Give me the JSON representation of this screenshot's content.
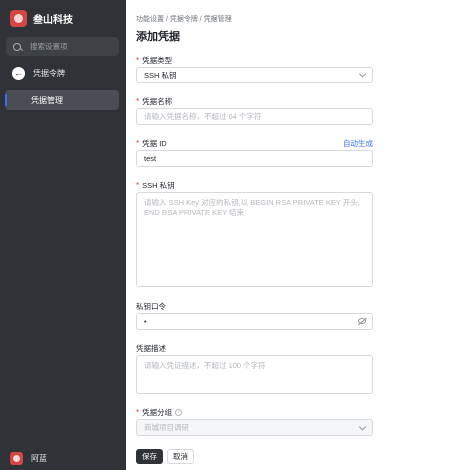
{
  "sidebar": {
    "brand": "叁山科技",
    "search_placeholder": "搜索设置项",
    "back_label": "凭据令牌",
    "active_item": "凭据管理",
    "user_name": "阿蓝"
  },
  "main": {
    "breadcrumb": "功能设置 / 凭据令牌 / 凭据管理",
    "title": "添加凭据",
    "fields": {
      "type": {
        "label": "凭据类型",
        "value": "SSH 私钥"
      },
      "name": {
        "label": "凭据名称",
        "placeholder": "请输入凭据名称，不超过 64 个字符"
      },
      "id": {
        "label": "凭据 ID",
        "value": "test",
        "auto_link": "自动生成"
      },
      "ssh_key": {
        "label": "SSH 私钥",
        "placeholder": "请输入 SSH Key 对应的私钥,以 BEGIN RSA PRIVATE KEY 开头, END RSA PRIVATE KEY 结束"
      },
      "passphrase": {
        "label": "私钥口令",
        "value": "•"
      },
      "desc": {
        "label": "凭据描述",
        "placeholder": "请输入凭证描述，不超过 100 个字符"
      },
      "group": {
        "label": "凭据分组",
        "placeholder": "商城项目调研"
      }
    },
    "buttons": {
      "save": "保存",
      "cancel": "取消"
    }
  },
  "icons": [
    "logo-icon",
    "search-icon",
    "back-arrow-icon",
    "chevron-down-icon",
    "eye-off-icon",
    "help-icon",
    "avatar-icon"
  ]
}
